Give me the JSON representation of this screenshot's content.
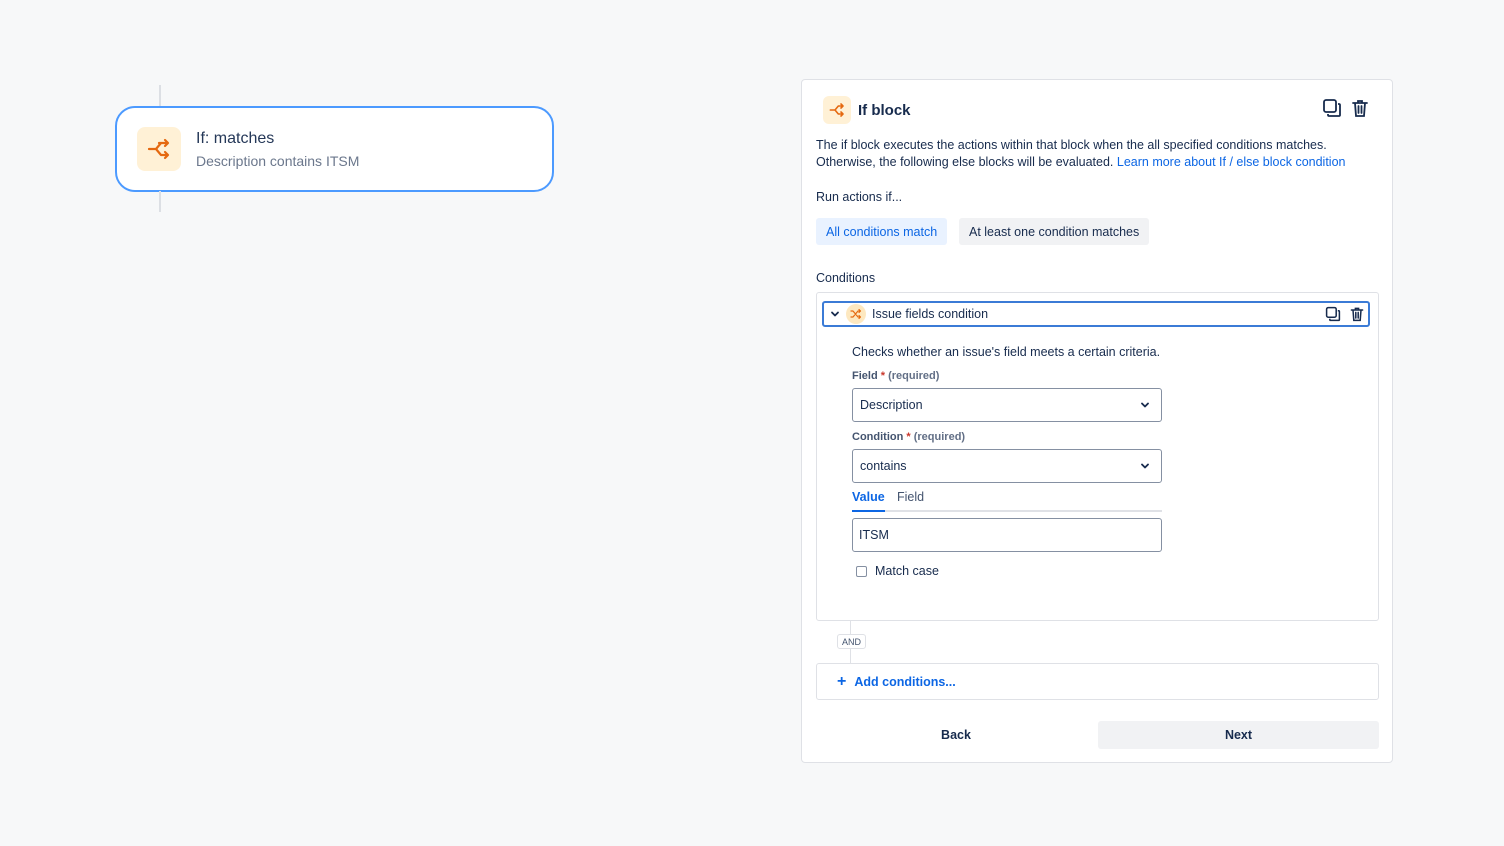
{
  "node": {
    "title": "If: matches",
    "subtitle": "Description contains ITSM",
    "icon": "branch-icon"
  },
  "panel": {
    "title": "If block",
    "description": "The if block executes the actions within that block when the all specified conditions matches. Otherwise, the following else blocks will be evaluated.",
    "learn_more": "Learn more about If / else block condition",
    "run_label": "Run actions if...",
    "mode_options": [
      "All conditions match",
      "At least one condition matches"
    ],
    "mode_selected": "All conditions match",
    "conditions_label": "Conditions",
    "condition": {
      "title": "Issue fields condition",
      "description": "Checks whether an issue's field meets a certain criteria.",
      "field_label": "Field",
      "field_value": "Description",
      "condition_label": "Condition",
      "condition_value": "contains",
      "required_text": "(required)",
      "tabs": [
        "Value",
        "Field"
      ],
      "active_tab": "Value",
      "value": "ITSM",
      "match_case_label": "Match case",
      "match_case_checked": false
    },
    "and_label": "AND",
    "add_conditions": "Add conditions...",
    "back": "Back",
    "next": "Next"
  },
  "colors": {
    "accent": "#0c66e4",
    "node_border": "#4c9aff",
    "icon_bg": "#fff1d6",
    "icon_fg": "#e56910"
  }
}
